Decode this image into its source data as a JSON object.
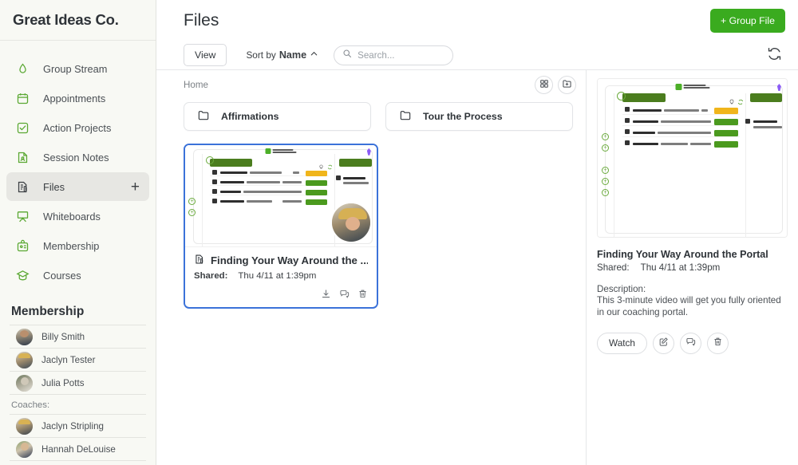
{
  "sidebar": {
    "brand": "Great Ideas Co.",
    "nav": [
      {
        "label": "Group Stream",
        "icon": "drop-icon",
        "active": false
      },
      {
        "label": "Appointments",
        "icon": "calendar-icon",
        "active": false
      },
      {
        "label": "Action Projects",
        "icon": "checkbox-icon",
        "active": false
      },
      {
        "label": "Session Notes",
        "icon": "note-person-icon",
        "active": false
      },
      {
        "label": "Files",
        "icon": "file-clip-icon",
        "active": true,
        "plus": "+"
      },
      {
        "label": "Whiteboards",
        "icon": "easel-icon",
        "active": false
      },
      {
        "label": "Membership",
        "icon": "id-badge-icon",
        "active": false
      },
      {
        "label": "Courses",
        "icon": "graduation-cap-icon",
        "active": false
      }
    ],
    "membership": {
      "heading": "Membership",
      "members": [
        {
          "name": "Billy Smith"
        },
        {
          "name": "Jaclyn Tester"
        },
        {
          "name": "Julia Potts"
        }
      ],
      "coaches_label": "Coaches:",
      "coaches": [
        {
          "name": "Jaclyn Stripling"
        },
        {
          "name": "Hannah DeLouise"
        }
      ]
    }
  },
  "header": {
    "title": "Files",
    "group_file_button": "+ Group File"
  },
  "toolbar": {
    "view_button": "View",
    "sort_prefix": "Sort by",
    "sort_value": "Name",
    "sort_direction_icon": "chevron-up-icon",
    "search_placeholder": "Search...",
    "search_value": "",
    "refresh_icon": "refresh-icon"
  },
  "breadcrumb": {
    "home": "Home",
    "grid_view_icon": "grid-view-icon",
    "new_folder_icon": "folder-plus-icon"
  },
  "folders": [
    {
      "name": "Affirmations",
      "icon": "folder-icon"
    },
    {
      "name": "Tour the Process",
      "icon": "folder-icon"
    }
  ],
  "files": [
    {
      "title": "Finding Your Way Around the ...",
      "shared_label": "Shared:",
      "shared_value": "Thu 4/11 at 1:39pm",
      "title_icon": "video-file-icon",
      "selected": true,
      "actions": [
        {
          "icon": "download-icon"
        },
        {
          "icon": "comment-icon"
        },
        {
          "icon": "trash-icon"
        }
      ]
    }
  ],
  "detail": {
    "title": "Finding Your Way Around the Portal",
    "shared_label": "Shared:",
    "shared_value": "Thu 4/11 at 1:39pm",
    "description_label": "Description:",
    "description": "This 3-minute video will get you fully oriented in our coaching portal.",
    "watch_button": "Watch",
    "edit_icon": "edit-icon",
    "comment_icon": "comment-icon",
    "delete_icon": "trash-icon"
  },
  "colors": {
    "brand_green": "#3aab1f",
    "icon_green": "#5aa832",
    "selection_blue": "#3b72d9",
    "sidebar_bg": "#f8f9f4",
    "text_primary": "#2e3338",
    "text_muted": "#7b8085"
  }
}
